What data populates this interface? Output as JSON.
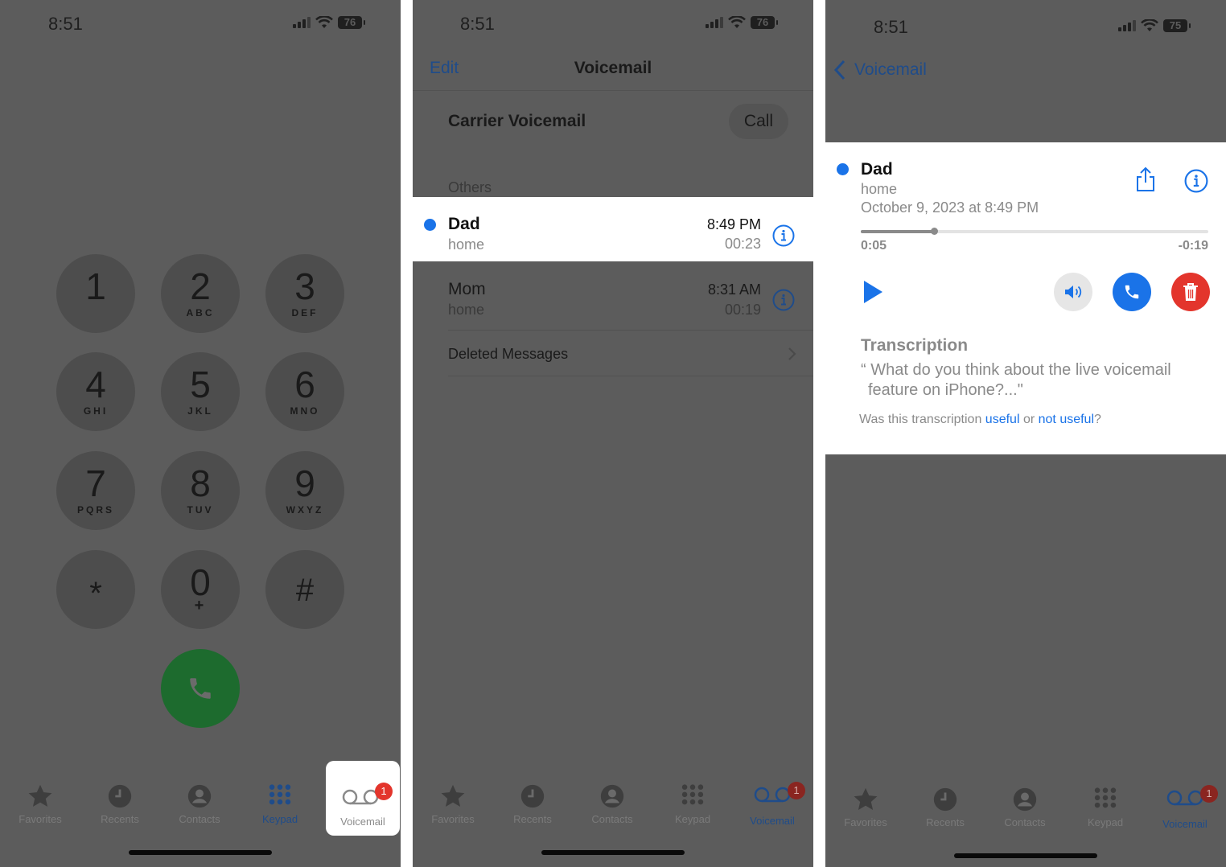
{
  "status": {
    "time": "8:51",
    "battery_1": "76",
    "battery_2": "76",
    "battery_3": "75"
  },
  "keypad": {
    "keys": [
      {
        "digit": "1",
        "letters": ""
      },
      {
        "digit": "2",
        "letters": "ABC"
      },
      {
        "digit": "3",
        "letters": "DEF"
      },
      {
        "digit": "4",
        "letters": "GHI"
      },
      {
        "digit": "5",
        "letters": "JKL"
      },
      {
        "digit": "6",
        "letters": "MNO"
      },
      {
        "digit": "7",
        "letters": "PQRS"
      },
      {
        "digit": "8",
        "letters": "TUV"
      },
      {
        "digit": "9",
        "letters": "WXYZ"
      },
      {
        "digit": "*",
        "letters": ""
      },
      {
        "digit": "0",
        "letters": "+"
      },
      {
        "digit": "#",
        "letters": ""
      }
    ]
  },
  "tabbar": {
    "favorites": "Favorites",
    "recents": "Recents",
    "contacts": "Contacts",
    "keypad": "Keypad",
    "voicemail": "Voicemail",
    "badge": "1"
  },
  "voicemail_list": {
    "edit": "Edit",
    "title": "Voicemail",
    "carrier": "Carrier Voicemail",
    "call": "Call",
    "section": "Others",
    "items": [
      {
        "name": "Dad",
        "label": "home",
        "time": "8:49 PM",
        "duration": "00:23"
      },
      {
        "name": "Mom",
        "label": "home",
        "time": "8:31 AM",
        "duration": "00:19"
      }
    ],
    "deleted": "Deleted Messages"
  },
  "voicemail_detail": {
    "back": "Voicemail",
    "name": "Dad",
    "label": "home",
    "date": "October 9, 2023 at 8:49 PM",
    "elapsed": "0:05",
    "remaining": "-0:19",
    "progress": 0.21,
    "transcription_title": "Transcription",
    "transcription_line1": "“ What do you think about the live voicemail",
    "transcription_line2": "feature on iPhone?...\"",
    "feedback_prefix": "Was this transcription ",
    "feedback_useful": "useful",
    "feedback_or": " or ",
    "feedback_not_useful": "not useful",
    "feedback_suffix": "?"
  },
  "colors": {
    "accent": "#1a73e8",
    "delete": "#e3352c",
    "call_green": "#1d6b2e",
    "dim_bg": "#5c5c5c"
  }
}
